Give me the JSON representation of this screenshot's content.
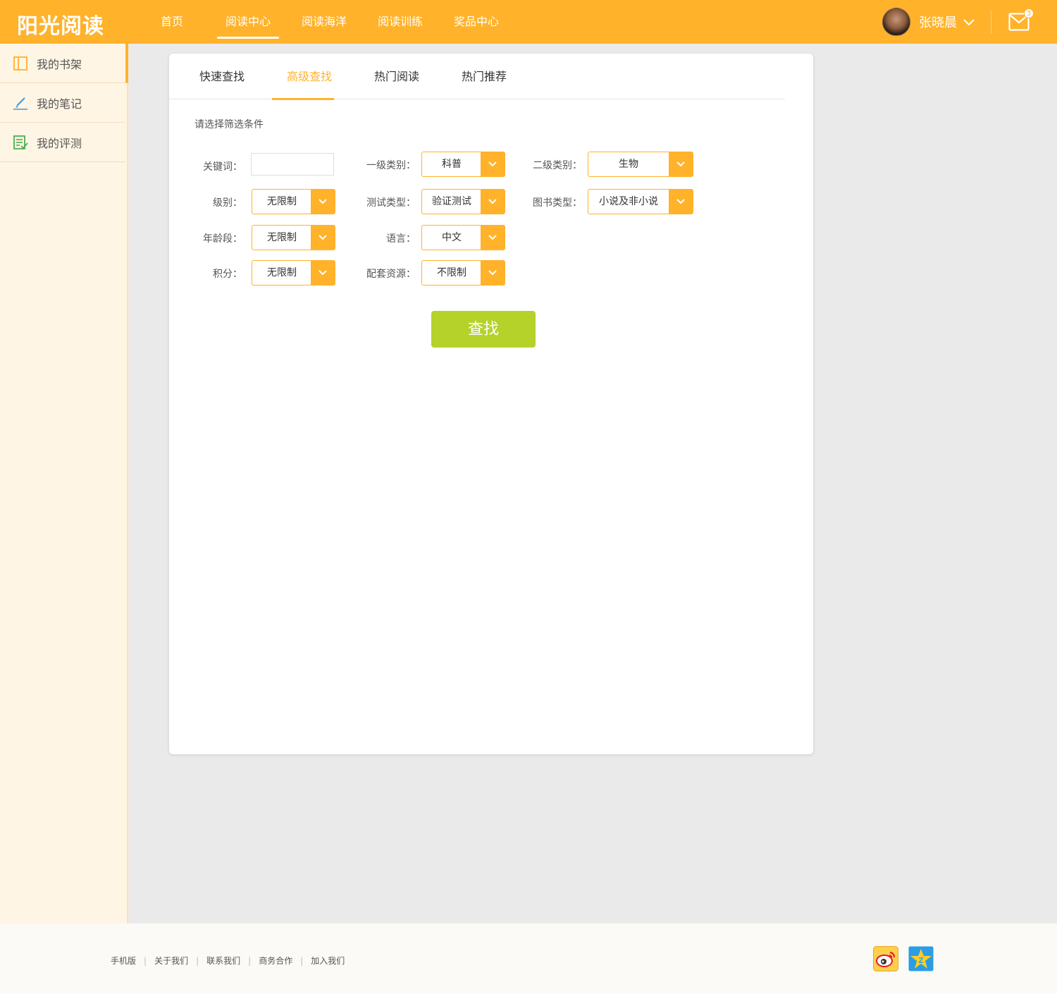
{
  "header": {
    "logo": "阳光阅读",
    "nav": [
      "首页",
      "阅读中心",
      "阅读海洋",
      "阅读训练",
      "奖品中心"
    ],
    "active_nav": 1,
    "username": "张晓晨",
    "mail_count": "3"
  },
  "sidebar": {
    "items": [
      {
        "label": "我的书架",
        "icon": "bookshelf-icon"
      },
      {
        "label": "我的笔记",
        "icon": "pencil-icon"
      },
      {
        "label": "我的评测",
        "icon": "checklist-icon"
      }
    ]
  },
  "tabs": [
    "快速查找",
    "高级查找",
    "热门阅读",
    "热门推荐"
  ],
  "form": {
    "prompt": "请选择筛选条件",
    "keyword": {
      "label": "关键词：",
      "value": ""
    },
    "category1": {
      "label": "一级类别：",
      "value": "科普"
    },
    "category2": {
      "label": "二级类别：",
      "value": "生物"
    },
    "level": {
      "label": "级别：",
      "value": "无限制"
    },
    "test_type": {
      "label": "测试类型：",
      "value": "验证测试"
    },
    "book_type": {
      "label": "图书类型：",
      "value": "小说及非小说"
    },
    "age": {
      "label": "年龄段：",
      "value": "无限制"
    },
    "language": {
      "label": "语言：",
      "value": "中文"
    },
    "points": {
      "label": "积分：",
      "value": "无限制"
    },
    "resources": {
      "label": "配套资源：",
      "value": "不限制"
    },
    "search_label": "查找"
  },
  "footer": {
    "links": [
      "手机版",
      "关于我们",
      "联系我们",
      "商务合作",
      "加入我们"
    ],
    "separator": "|",
    "social": [
      "weibo-icon",
      "qzone-icon"
    ]
  },
  "colors": {
    "accent": "#ffb22a",
    "search_button": "#b5d22a",
    "sidebar_bg": "#fff5e4"
  }
}
